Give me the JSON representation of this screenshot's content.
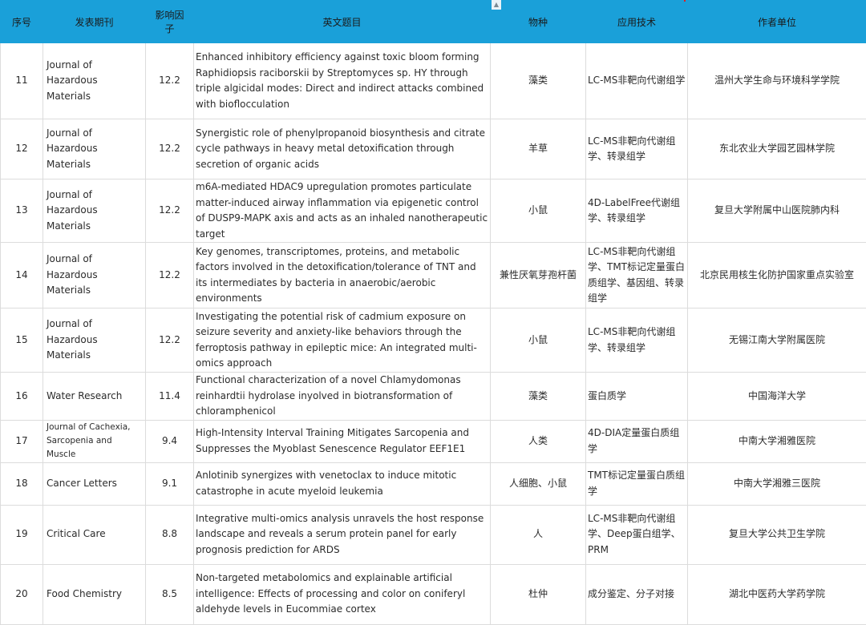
{
  "header": {
    "idx": "序号",
    "journal": "发表期刊",
    "impact": "影响因子",
    "title": "英文题目",
    "species": "物种",
    "tech": "应用技术",
    "affiliation": "作者单位"
  },
  "rows": [
    {
      "idx": "11",
      "journal": "Journal of Hazardous Materials",
      "impact": "12.2",
      "title": "Enhanced inhibitory efficiency against toxic bloom forming Raphidiopsis raciborskii by Streptomyces sp. HY through triple algicidal modes: Direct and indirect attacks combined with bioflocculation",
      "species": "藻类",
      "tech": "LC-MS非靶向代谢组学",
      "affiliation": "温州大学生命与环境科学学院"
    },
    {
      "idx": "12",
      "journal": "Journal of Hazardous Materials",
      "impact": "12.2",
      "title": "Synergistic role of phenylpropanoid biosynthesis and citrate cycle pathways in heavy metal detoxification through secretion of organic acids",
      "species": "羊草",
      "tech": "LC-MS非靶向代谢组学、转录组学",
      "affiliation": "东北农业大学园艺园林学院"
    },
    {
      "idx": "13",
      "journal": "Journal of Hazardous Materials",
      "impact": "12.2",
      "title": "m6A-mediated HDAC9 upregulation promotes particulate matter-induced airway inflammation via epigenetic control of DUSP9-MAPK axis and acts as an inhaled nanotherapeutic target",
      "species": "小鼠",
      "tech": "4D-LabelFree代谢组学、转录组学",
      "affiliation": "复旦大学附属中山医院肺内科"
    },
    {
      "idx": "14",
      "journal": "Journal of Hazardous Materials",
      "impact": "12.2",
      "title": "Key genomes, transcriptomes, proteins, and metabolic factors involved in the detoxification/tolerance of TNT and its intermediates by bacteria in anaerobic/aerobic environments",
      "species": "兼性厌氧芽孢杆菌",
      "tech": "LC-MS非靶向代谢组学、TMT标记定量蛋白质组学、基因组、转录组学",
      "affiliation": "北京民用核生化防护国家重点实验室"
    },
    {
      "idx": "15",
      "journal": "Journal of Hazardous Materials",
      "impact": "12.2",
      "title": "Investigating the potential risk of cadmium exposure on seizure severity and anxiety-like behaviors through the ferroptosis pathway in epileptic mice: An integrated multi-omics approach",
      "species": "小鼠",
      "tech": "LC-MS非靶向代谢组学、转录组学",
      "affiliation": "无锡江南大学附属医院"
    },
    {
      "idx": "16",
      "journal": "Water Research",
      "impact": "11.4",
      "title": "Functional characterization of a novel Chlamydomonas reinhardtii hydrolase inyolved in biotransformation of chloramphenicol",
      "species": "藻类",
      "tech": "蛋白质学",
      "affiliation": "中国海洋大学"
    },
    {
      "idx": "17",
      "journal": "Journal of Cachexia, Sarcopenia and Muscle",
      "impact": "9.4",
      "title": "High-Intensity Interval Training Mitigates Sarcopenia and Suppresses the Myoblast Senescence Regulator EEF1E1",
      "species": "人类",
      "tech": "4D-DIA定量蛋白质组学",
      "affiliation": "中南大学湘雅医院"
    },
    {
      "idx": "18",
      "journal": "Cancer Letters",
      "impact": "9.1",
      "title": "Anlotinib synergizes with venetoclax to induce mitotic catastrophe in acute myeloid leukemia",
      "species": "人细胞、小鼠",
      "tech": "TMT标记定量蛋白质组学",
      "affiliation": "中南大学湘雅三医院"
    },
    {
      "idx": "19",
      "journal": "Critical Care",
      "impact": "8.8",
      "title": "Integrative multi-omics analysis unravels the host response landscape and reveals a serum protein panel for early prognosis prediction for ARDS",
      "species": "人",
      "tech": "LC-MS非靶向代谢组学、Deep蛋白组学、PRM",
      "affiliation": "复旦大学公共卫生学院"
    },
    {
      "idx": "20",
      "journal": "Food Chemistry",
      "impact": "8.5",
      "title": "Non-targeted metabolomics and explainable artificial intelligence: Effects of processing and color on coniferyl aldehyde levels in Eucommiae cortex",
      "species": "杜仲",
      "tech": "成分鉴定、分子对接",
      "affiliation": "湖北中医药大学药学院"
    }
  ]
}
